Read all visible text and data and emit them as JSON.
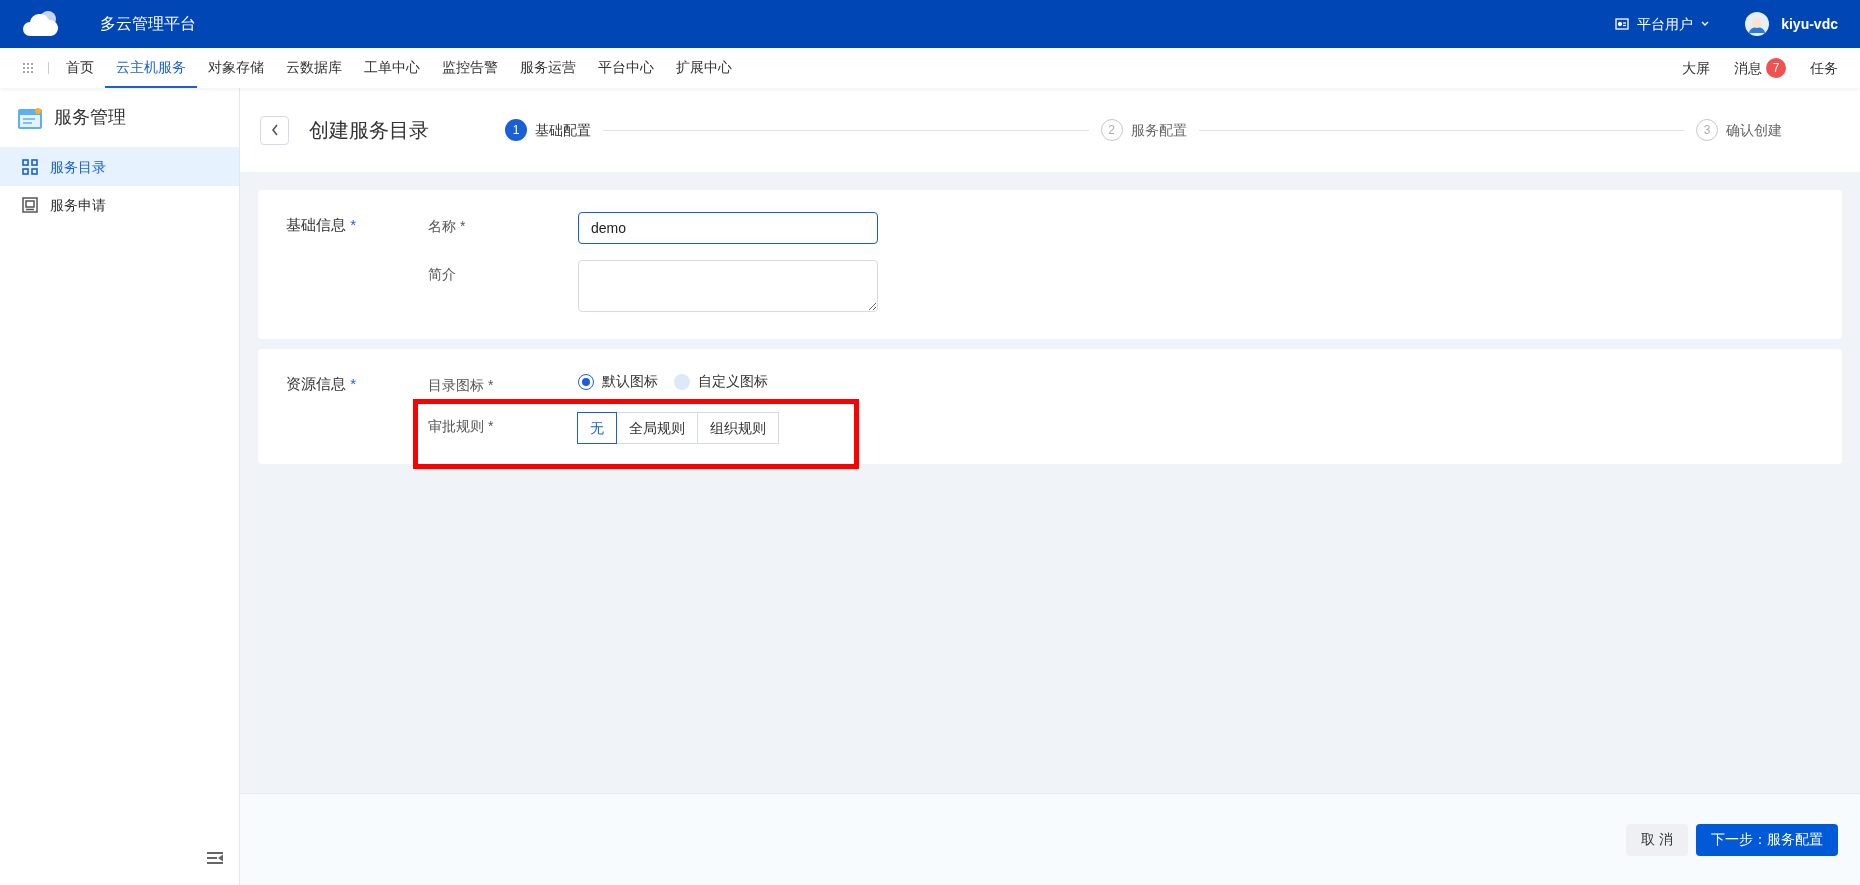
{
  "topbar": {
    "title": "多云管理平台",
    "role": "平台用户",
    "user": "kiyu-vdc"
  },
  "nav": {
    "items": [
      {
        "label": "首页",
        "selected": false
      },
      {
        "label": "云主机服务",
        "selected": true
      },
      {
        "label": "对象存储",
        "selected": false
      },
      {
        "label": "云数据库",
        "selected": false
      },
      {
        "label": "工单中心",
        "selected": false
      },
      {
        "label": "监控告警",
        "selected": false
      },
      {
        "label": "服务运营",
        "selected": false
      },
      {
        "label": "平台中心",
        "selected": false
      },
      {
        "label": "扩展中心",
        "selected": false
      }
    ],
    "right": [
      {
        "label": "大屏"
      },
      {
        "label": "消息",
        "badge": "7"
      },
      {
        "label": "任务"
      }
    ]
  },
  "sidebar": {
    "title": "服务管理",
    "items": [
      {
        "label": "服务目录",
        "kind": "grid",
        "selected": true
      },
      {
        "label": "服务申请",
        "kind": "frame",
        "selected": false
      }
    ]
  },
  "header": {
    "title": "创建服务目录",
    "steps": [
      {
        "number": "1",
        "label": "基础配置",
        "selected": true
      },
      {
        "number": "2",
        "label": "服务配置",
        "selected": false
      },
      {
        "number": "3",
        "label": "确认创建",
        "selected": false
      }
    ]
  },
  "sections": [
    {
      "title": "基础信息",
      "required": "*",
      "rows": [
        {
          "kind": "input",
          "label": "名称",
          "required": "*",
          "value": "demo",
          "focused": true,
          "highlighted": false
        },
        {
          "kind": "textarea",
          "label": "简介",
          "highlighted": false
        }
      ]
    },
    {
      "title": "资源信息",
      "required": "*",
      "rows": [
        {
          "kind": "radio",
          "label": "目录图标",
          "required": "*",
          "highlighted": false,
          "options": [
            {
              "label": "默认图标",
              "selected": true
            },
            {
              "label": "自定义图标",
              "selected": false
            }
          ]
        },
        {
          "kind": "segmented",
          "label": "审批规则",
          "required": "*",
          "highlighted": true,
          "options": [
            {
              "label": "无",
              "selected": true
            },
            {
              "label": "全局规则",
              "selected": false
            },
            {
              "label": "组织规则",
              "selected": false
            }
          ]
        }
      ]
    }
  ],
  "footer": {
    "buttons": [
      {
        "label": "取 消",
        "kind": "secondary"
      },
      {
        "label": "下一步：服务配置",
        "kind": "primary"
      }
    ]
  }
}
